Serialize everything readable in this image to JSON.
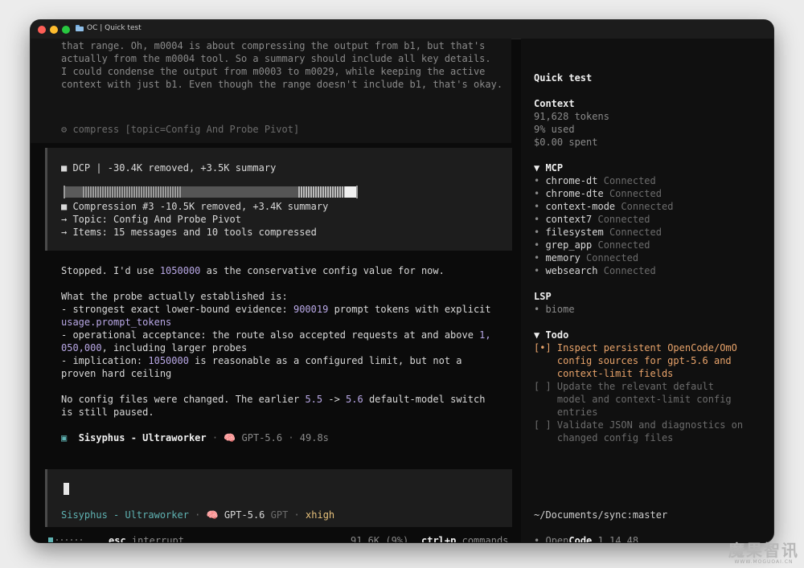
{
  "window": {
    "title": "OC | Quick test"
  },
  "reasoning": {
    "lines": [
      "that range. Oh, m0004 is about compressing the output from b1, but that's",
      "actually from the m0004 tool. So a summary should include all key details.",
      "I could condense the output from m0003 to m0029, while keeping the active",
      "context with just b1. Even though the range doesn't include b1, that's okay."
    ],
    "tool_call": "⚙ compress [topic=Config And Probe Pivot]"
  },
  "dcp": {
    "header": "■ DCP | -30.4K removed, +3.5K summary",
    "compression": "■ Compression #3 -10.5K removed, +3.4K summary",
    "topic": "→ Topic: Config And Probe Pivot",
    "items": "→ Items: 15 messages and 10 tools compressed"
  },
  "response": {
    "l1_a": "Stopped. I'd use ",
    "l1_num": "1050000",
    "l1_b": " as the conservative config value for now.",
    "l2": "What the probe actually established is:",
    "l3_a": "- strongest exact lower-bound evidence: ",
    "l3_num": "900019",
    "l3_b": " prompt tokens with explicit",
    "l4_code": "usage.prompt_tokens",
    "l5_a": "- operational acceptance: the route also accepted requests at and above ",
    "l5_num": "1,",
    "l6_num": "050,000",
    "l6_b": ", including larger probes",
    "l7_a": "- implication: ",
    "l7_num": "1050000",
    "l7_b": " is reasonable as a configured limit, but not a",
    "l8": "proven hard ceiling",
    "l9_a": "No config files were changed. The earlier ",
    "l9_n1": "5.5",
    "l9_arrow": " -> ",
    "l9_n2": "5.6",
    "l9_b": " default-model switch",
    "l10": "is still paused."
  },
  "agent_footer": {
    "icon": "▣",
    "agent": "Sisyphus - Ultraworker",
    "sep": " · ",
    "brain": "🧠",
    "model": "GPT-5.6",
    "duration": "49.8s"
  },
  "input_bar": {
    "agent": "Sisyphus - Ultraworker",
    "sep": " · ",
    "brain": "🧠",
    "model": "GPT-5.6",
    "provider": "GPT",
    "sep2": " · ",
    "effort": "xhigh"
  },
  "status_bar": {
    "esc": "esc",
    "esc_label": "interrupt",
    "tokens": "91.6K (9%)",
    "shortcut": "ctrl+p",
    "shortcut_label": "commands"
  },
  "sidebar": {
    "title": "Quick test",
    "context": {
      "heading": "Context",
      "tokens": "91,628 tokens",
      "used": "9% used",
      "spent": "$0.00 spent"
    },
    "mcp": {
      "heading": "▼ MCP",
      "items": [
        {
          "name": "chrome-dt",
          "status": "Connected"
        },
        {
          "name": "chrome-dte",
          "status": "Connected"
        },
        {
          "name": "context-mode",
          "status": "Connected"
        },
        {
          "name": "context7",
          "status": "Connected"
        },
        {
          "name": "filesystem",
          "status": "Connected"
        },
        {
          "name": "grep_app",
          "status": "Connected"
        },
        {
          "name": "memory",
          "status": "Connected"
        },
        {
          "name": "websearch",
          "status": "Connected"
        }
      ]
    },
    "lsp": {
      "heading": "LSP",
      "item": "• biome"
    },
    "todo": {
      "heading": "▼ Todo",
      "items": [
        {
          "box": "[•]",
          "lines": [
            "Inspect persistent OpenCode/OmO",
            "config sources for gpt-5.6 and",
            "context-limit fields"
          ],
          "active": true
        },
        {
          "box": "[ ]",
          "lines": [
            "Update the relevant default",
            "model and context-limit config",
            "entries"
          ],
          "active": false
        },
        {
          "box": "[ ]",
          "lines": [
            "Validate JSON and diagnostics on",
            "changed config files"
          ],
          "active": false
        }
      ]
    },
    "cwd": "~/Documents/sync:master",
    "version": {
      "bullet": "•",
      "brand_a": "Open",
      "brand_b": "Code",
      "number": "1.14.48"
    }
  },
  "watermark": {
    "text": "魔果智讯",
    "url": "WWW.MOGUOAI.CN"
  },
  "colors": {
    "accent_teal": "#5fb3b3",
    "number_purple": "#b9a8e6",
    "todo_active": "#e8a36a",
    "effort_yellow": "#e6c07b"
  }
}
